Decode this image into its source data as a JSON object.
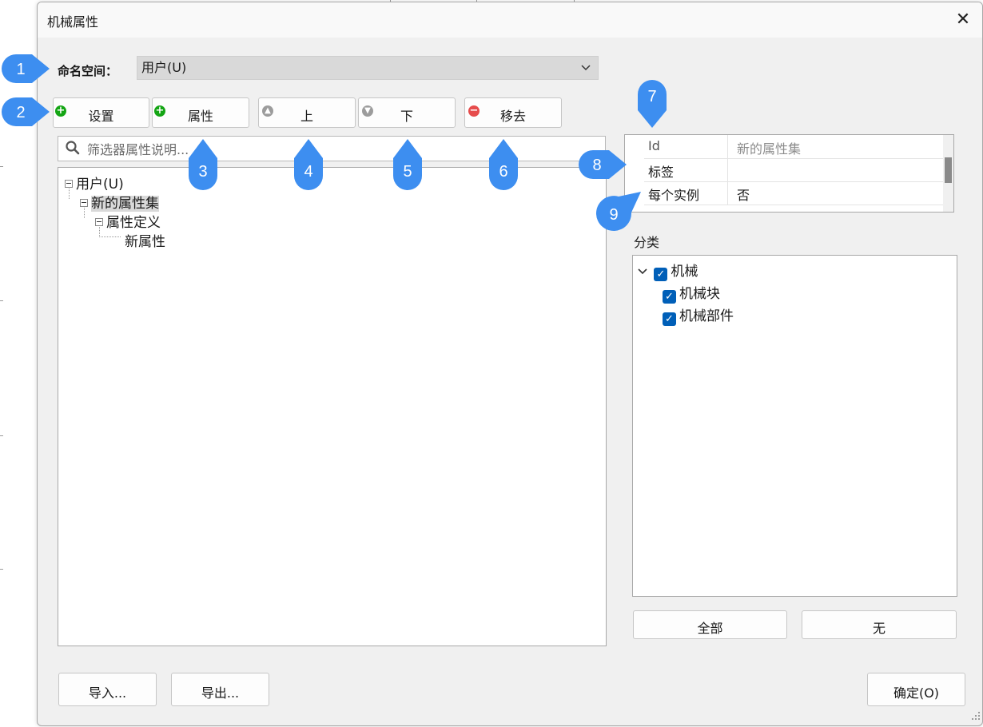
{
  "window": {
    "title": "机械属性",
    "close_glyph": "✕"
  },
  "namespace": {
    "label": "命名空间：",
    "value": "用户(U)"
  },
  "toolbar": {
    "setup_label": "设置",
    "property_label": "属性",
    "up_label": "上",
    "down_label": "下",
    "remove_label": "移去"
  },
  "search": {
    "placeholder": "筛选器属性说明..."
  },
  "tree": {
    "root": "用户(U)",
    "set": "新的属性集",
    "definition": "属性定义",
    "leaf": "新属性"
  },
  "properties": {
    "rows": [
      {
        "key": "Id",
        "value": "新的属性集"
      },
      {
        "key": "标签",
        "value": ""
      },
      {
        "key": "每个实例",
        "value": "否"
      }
    ]
  },
  "category": {
    "label": "分类",
    "items": [
      {
        "label": "机械",
        "checked": true
      },
      {
        "label": "机械块",
        "checked": true
      },
      {
        "label": "机械部件",
        "checked": true
      }
    ],
    "all_label": "全部",
    "none_label": "无"
  },
  "footer": {
    "import_label": "导入...",
    "export_label": "导出...",
    "ok_label": "确定(O)"
  },
  "callouts": [
    "1",
    "2",
    "3",
    "4",
    "5",
    "6",
    "7",
    "8",
    "9"
  ],
  "colors": {
    "callout": "#3d8ef0",
    "checkbox": "#005fb8",
    "add_icon": "#14a514",
    "remove_icon": "#e64c4c"
  },
  "icons": [
    "close-icon",
    "chevron-down-icon",
    "plus-circle-icon",
    "up-circle-icon",
    "down-circle-icon",
    "minus-circle-icon",
    "search-icon",
    "chevron-down-icon",
    "check-icon",
    "resize-grip-icon"
  ]
}
